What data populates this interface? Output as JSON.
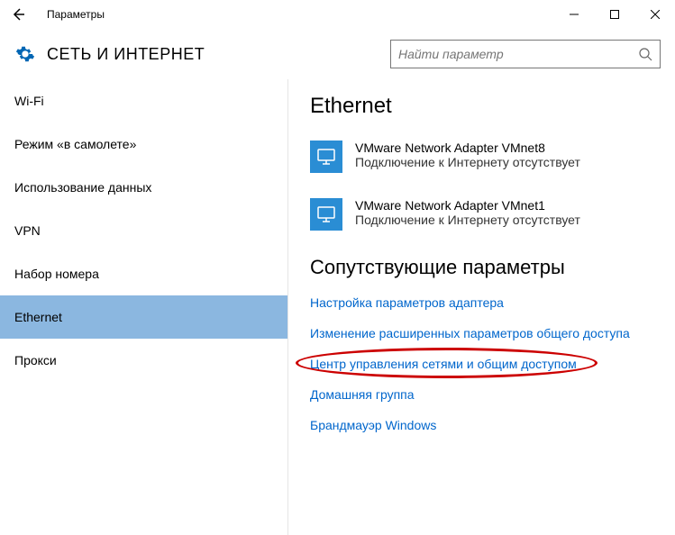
{
  "window": {
    "title": "Параметры"
  },
  "header": {
    "title": "СЕТЬ И ИНТЕРНЕТ",
    "search_placeholder": "Найти параметр"
  },
  "sidebar": {
    "items": [
      {
        "label": "Wi-Fi"
      },
      {
        "label": "Режим «в самолете»"
      },
      {
        "label": "Использование данных"
      },
      {
        "label": "VPN"
      },
      {
        "label": "Набор номера"
      },
      {
        "label": "Ethernet"
      },
      {
        "label": "Прокси"
      }
    ],
    "active_index": 5
  },
  "main": {
    "title": "Ethernet",
    "adapters": [
      {
        "name": "VMware Network Adapter VMnet8",
        "status": "Подключение к Интернету отсутствует"
      },
      {
        "name": "VMware Network Adapter VMnet1",
        "status": "Подключение к Интернету отсутствует"
      }
    ],
    "related_title": "Сопутствующие параметры",
    "links": [
      "Настройка параметров адаптера",
      "Изменение расширенных параметров общего доступа",
      "Центр управления сетями и общим доступом",
      "Домашняя группа",
      "Брандмауэр Windows"
    ],
    "annotated_link_index": 2
  }
}
